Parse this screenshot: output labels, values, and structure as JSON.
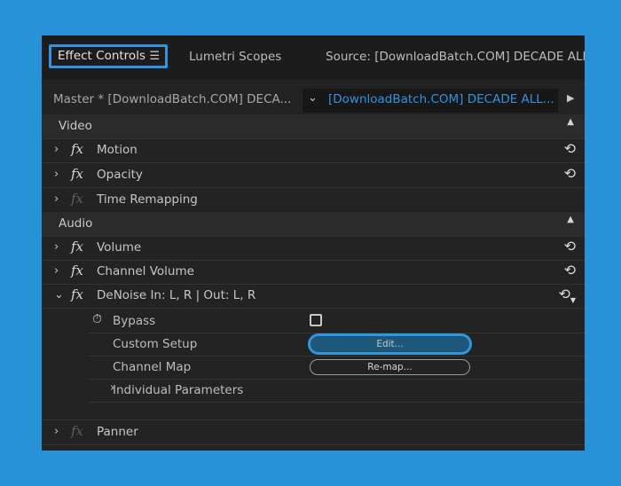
{
  "tabs": {
    "effect_controls": "Effect Controls",
    "effect_controls_menu": "☰",
    "lumetri_scopes": "Lumetri Scopes",
    "source": "Source: [DownloadBatch.COM]  DECADE ALL"
  },
  "sequence_bar": {
    "master": "Master * [DownloadBatch.COM]  DECA...",
    "selected": "[DownloadBatch.COM]  DECADE ALL..."
  },
  "video": {
    "label": "Video",
    "effects": [
      "Motion",
      "Opacity",
      "Time Remapping"
    ]
  },
  "audio": {
    "label": "Audio",
    "effects": [
      "Volume",
      "Channel Volume",
      "DeNoise In: L, R | Out: L, R",
      "Panner"
    ]
  },
  "fx_symbol": "fx",
  "denoise_params": {
    "bypass": "Bypass",
    "custom_setup": "Custom Setup",
    "edit_button": "Edit...",
    "channel_map": "Channel Map",
    "remap_button": "Re-map...",
    "individual_parameters": "Individual Parameters"
  },
  "colors": {
    "accent": "#2f95dc",
    "panel_bg": "#232323",
    "frame_bg": "#2792d8"
  }
}
